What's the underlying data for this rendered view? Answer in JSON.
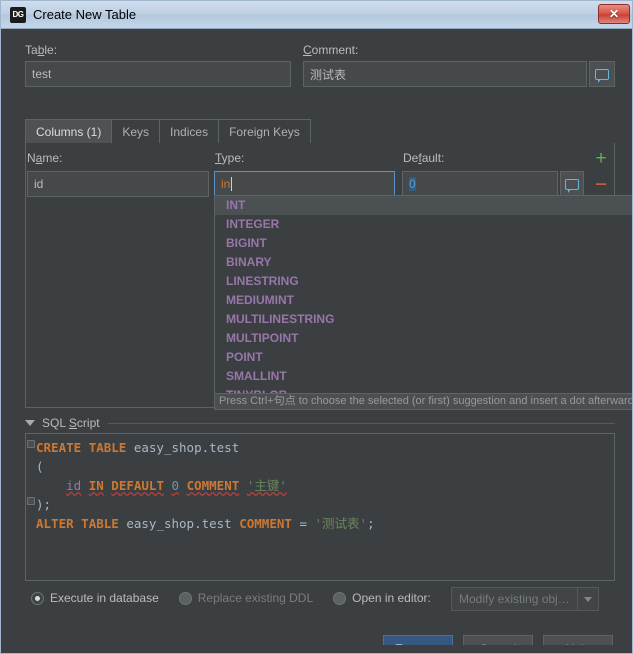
{
  "window": {
    "title": "Create New Table",
    "app_icon": "datagrip-icon",
    "app_icon_text": "DG",
    "close_label": "✕"
  },
  "form": {
    "table_label": "Table:",
    "table_value": "test",
    "comment_label": "Comment:",
    "comment_value": "测试表",
    "comment_button_icon": "speech-bubble-icon"
  },
  "tabs": [
    {
      "label": "Columns (1)",
      "active": true
    },
    {
      "label": "Keys",
      "active": false
    },
    {
      "label": "Indices",
      "active": false
    },
    {
      "label": "Foreign Keys",
      "active": false
    }
  ],
  "columns_panel": {
    "name_label": "Name:",
    "type_label": "Type:",
    "default_label": "Default:",
    "name_value": "id",
    "type_value": "in",
    "default_value": "0",
    "default_button_icon": "speech-bubble-icon",
    "add_button": "+",
    "remove_button": "−"
  },
  "autocomplete": {
    "items": [
      "INT",
      "INTEGER",
      "BIGINT",
      "BINARY",
      "LINESTRING",
      "MEDIUMINT",
      "MULTILINESTRING",
      "MULTIPOINT",
      "POINT",
      "SMALLINT",
      "TINYBLOB"
    ],
    "selected_index": 0,
    "hint": "Press Ctrl+句点 to choose the selected (or first) suggestion and insert a dot afterwards"
  },
  "sql_section": {
    "title": "SQL Script",
    "lines": [
      {
        "tokens": [
          {
            "t": "CREATE",
            "c": "k"
          },
          {
            "t": " ",
            "c": "p"
          },
          {
            "t": "TABLE",
            "c": "k"
          },
          {
            "t": " ",
            "c": "p"
          },
          {
            "t": "easy_shop.test",
            "c": "id"
          }
        ]
      },
      {
        "tokens": [
          {
            "t": "(",
            "c": "p"
          }
        ]
      },
      {
        "tokens": [
          {
            "t": "    ",
            "c": "p"
          },
          {
            "t": "id",
            "c": "v"
          },
          {
            "t": " ",
            "c": "p"
          },
          {
            "t": "IN",
            "c": "k"
          },
          {
            "t": " ",
            "c": "p"
          },
          {
            "t": "DEFAULT",
            "c": "k"
          },
          {
            "t": " ",
            "c": "p"
          },
          {
            "t": "0",
            "c": "n"
          },
          {
            "t": " ",
            "c": "p"
          },
          {
            "t": "COMMENT",
            "c": "k"
          },
          {
            "t": " ",
            "c": "p"
          },
          {
            "t": "'主键'",
            "c": "s"
          }
        ]
      },
      {
        "tokens": [
          {
            "t": ");",
            "c": "p"
          }
        ]
      },
      {
        "tokens": [
          {
            "t": "ALTER",
            "c": "k"
          },
          {
            "t": " ",
            "c": "p"
          },
          {
            "t": "TABLE",
            "c": "k"
          },
          {
            "t": " ",
            "c": "p"
          },
          {
            "t": "easy_shop.test",
            "c": "id"
          },
          {
            "t": " ",
            "c": "p"
          },
          {
            "t": "COMMENT",
            "c": "k"
          },
          {
            "t": " = ",
            "c": "p"
          },
          {
            "t": "'测试表'",
            "c": "s"
          },
          {
            "t": ";",
            "c": "p"
          }
        ]
      }
    ]
  },
  "options": {
    "radios": [
      {
        "label": "Execute in database",
        "selected": true,
        "disabled": false
      },
      {
        "label": "Replace existing DDL",
        "selected": false,
        "disabled": true
      },
      {
        "label": "Open in editor:",
        "selected": false,
        "disabled": false
      }
    ],
    "combo_value": "Modify existing obj…",
    "combo_icon": "chevron-down-icon"
  },
  "buttons": {
    "execute": "Execute",
    "cancel": "Cancel",
    "help": "Help"
  },
  "colors": {
    "dialog_bg": "#3c3f41",
    "accent": "#365880",
    "keyword": "#cc7832",
    "string": "#6a8759",
    "number": "#6897bb",
    "variable": "#9876aa",
    "add": "#62b543",
    "remove": "#d4603e"
  }
}
